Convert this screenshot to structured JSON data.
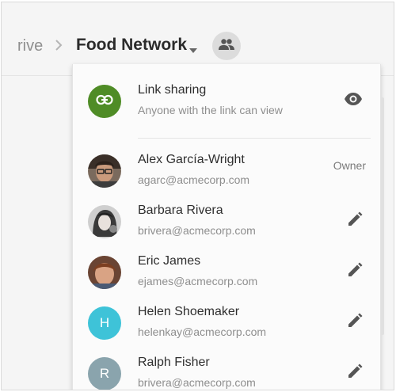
{
  "breadcrumb": {
    "previous": "rive",
    "current": "Food Network"
  },
  "link_sharing": {
    "title": "Link sharing",
    "subtitle": "Anyone with the link can view",
    "color": "#4f8c26",
    "icon": "link-icon",
    "action_icon": "eye-icon"
  },
  "people": [
    {
      "name": "Alex García-Wright",
      "email": "agarc@acmecorp.com",
      "role": "Owner",
      "avatar": "photo"
    },
    {
      "name": "Barbara Rivera",
      "email": "brivera@acmecorp.com",
      "role": "",
      "avatar": "photo",
      "action_icon": "pencil-icon"
    },
    {
      "name": "Eric James",
      "email": "ejames@acmecorp.com",
      "role": "",
      "avatar": "photo",
      "action_icon": "pencil-icon"
    },
    {
      "name": "Helen Shoemaker",
      "email": "helenkay@acmecorp.com",
      "role": "",
      "avatar": "initial",
      "initial": "H",
      "color": "#3ec3d8",
      "action_icon": "pencil-icon"
    },
    {
      "name": "Ralph Fisher",
      "email": "brivera@acmecorp.com",
      "role": "",
      "avatar": "initial",
      "initial": "R",
      "color": "#8aa4ad",
      "action_icon": "pencil-icon"
    }
  ]
}
